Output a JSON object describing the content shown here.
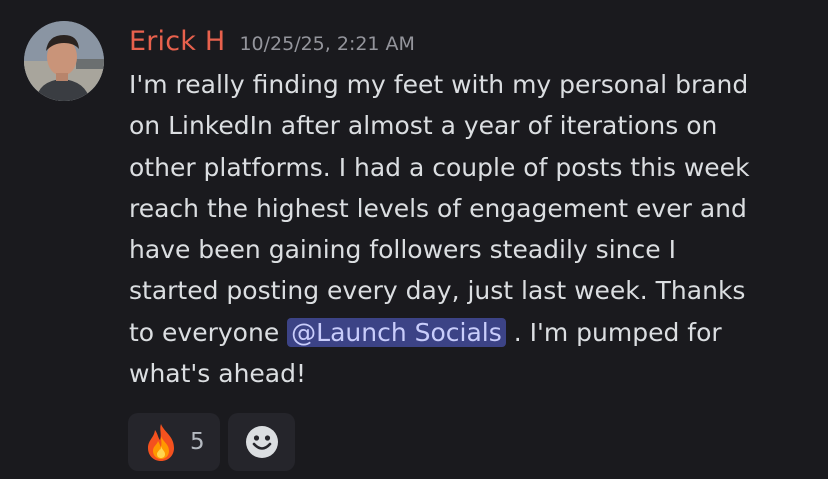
{
  "message": {
    "author": "Erick H",
    "timestamp": "10/25/25, 2:21 AM",
    "content_lines": [
      "I'm really finding my feet with my personal brand",
      "on LinkedIn after almost a year of iterations on",
      "other platforms. I had a couple of posts this week",
      "reach the highest levels of engagement ever and",
      "have been gaining followers steadily since I",
      "started posting every day, just last week. Thanks"
    ],
    "content_before_mention": "to everyone ",
    "mention": "@Launch Socials",
    "content_after_mention": " . I'm pumped for",
    "content_last_line": "what's ahead!"
  },
  "reactions": [
    {
      "icon": "fire-emoji-icon",
      "count": "5"
    }
  ],
  "add_reaction_icon": "smiley-face-icon",
  "colors": {
    "background": "#1a1a1e",
    "author": "#e8614d",
    "timestamp": "#94959c",
    "text": "#dbdee1",
    "mention_bg": "#3c4386",
    "mention_text": "#c9cdfb",
    "reaction_bg": "#25252b"
  }
}
